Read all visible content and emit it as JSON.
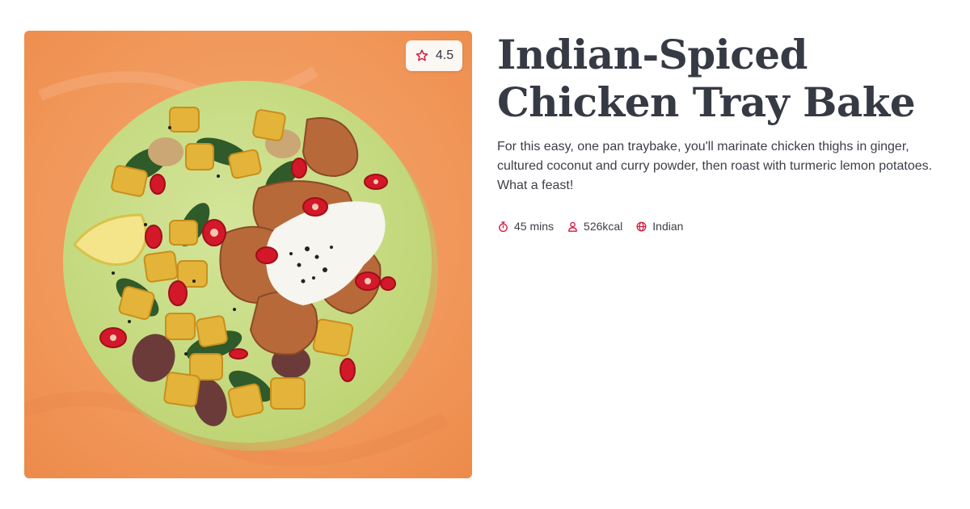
{
  "recipe": {
    "title": "Indian-Spiced Chicken Tray Bake",
    "description": "For this easy, one pan traybake, you'll marinate chicken thighs in ginger, cultured coconut and curry powder, then roast with turmeric lemon potatoes. What a feast!",
    "rating": "4.5",
    "meta": {
      "time": "45 mins",
      "calories": "526kcal",
      "cuisine": "Indian"
    }
  },
  "icons": {
    "rating": "star-icon",
    "time": "timer-icon",
    "calories": "person-icon",
    "cuisine": "globe-icon"
  },
  "colors": {
    "accent": "#d6193f",
    "title": "#363a44",
    "text": "#3c3f46",
    "background": "#ffffff",
    "photo_background": "#f19b63",
    "plate": "#c9df83"
  }
}
